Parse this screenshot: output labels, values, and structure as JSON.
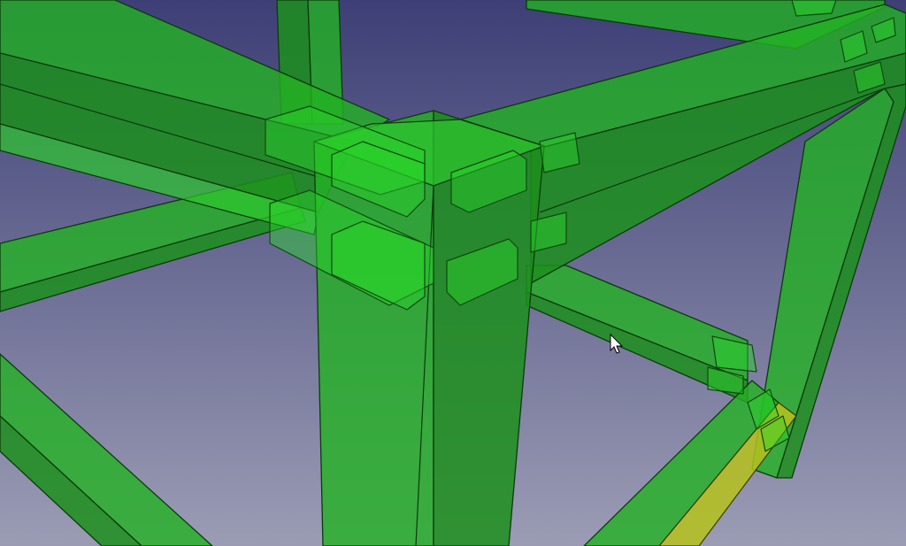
{
  "viewport": {
    "background_top": "#3d3f76",
    "background_bottom": "#9b9cb4",
    "model_color": "#23b223",
    "selection_color": "#b5c21c"
  },
  "cursor": {
    "icon": "arrow-cursor-icon"
  }
}
